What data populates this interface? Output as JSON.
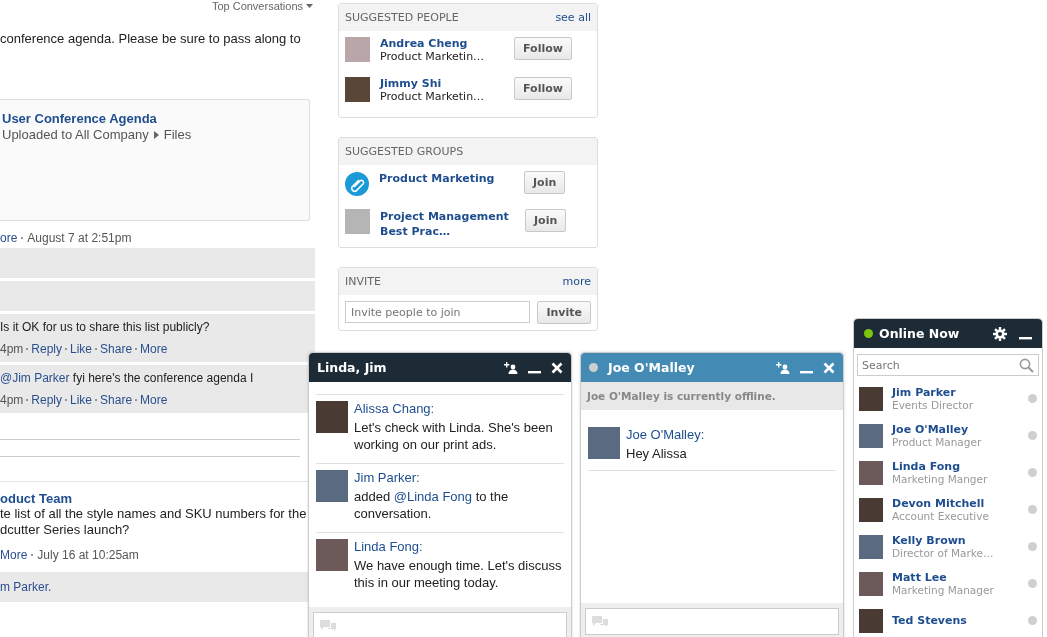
{
  "feed": {
    "sort_menu": "Top Conversations",
    "post_text": "conference agenda. Please be sure to pass along to",
    "attachment": {
      "title": "User Conference Agenda",
      "location": "Uploaded to All Company",
      "folder": "Files"
    },
    "post_meta": [
      {
        "text": "ore",
        "link": true
      },
      {
        "text": "August 7 at 2:51pm",
        "link": false
      }
    ],
    "comments": [
      {
        "text": "Is it OK for us to share this list publicly?",
        "actions": [
          {
            "text": "4pm",
            "link": false
          },
          {
            "text": "Reply",
            "link": true
          },
          {
            "text": "Like",
            "link": true
          },
          {
            "text": "Share",
            "link": true
          },
          {
            "text": "More",
            "link": true
          }
        ]
      },
      {
        "mention": "@Jim Parker",
        "text": "fyi here's the conference agenda I",
        "actions": [
          {
            "text": "4pm",
            "link": false
          },
          {
            "text": "Reply",
            "link": true
          },
          {
            "text": "Like",
            "link": true
          },
          {
            "text": "Share",
            "link": true
          },
          {
            "text": "More",
            "link": true
          }
        ]
      }
    ],
    "second_post": {
      "group": "oduct Team",
      "lines": [
        "te list of all the style names and SKU numbers for the",
        "dcutter Series launch?"
      ],
      "meta": [
        {
          "text": "More",
          "link": true
        },
        {
          "text": "July 16 at 10:25am",
          "link": false
        }
      ],
      "liked_by": "m Parker."
    }
  },
  "sidebar": {
    "people": {
      "title": "SUGGESTED PEOPLE",
      "link": "see all",
      "items": [
        {
          "name": "Andrea Cheng",
          "role": "Product Marketin…",
          "button": "Follow"
        },
        {
          "name": "Jimmy Shi",
          "role": "Product Marketin…",
          "button": "Follow"
        }
      ]
    },
    "groups": {
      "title": "SUGGESTED GROUPS",
      "items": [
        {
          "kind": "icon",
          "name": "Product Marketing",
          "button": "Join"
        },
        {
          "kind": "photo",
          "name": "Project Management Best Prac…",
          "button": "Join"
        }
      ]
    },
    "invite": {
      "title": "INVITE",
      "link": "more",
      "placeholder": "Invite people to join",
      "button": "Invite"
    }
  },
  "chats": [
    {
      "title": "Linda, Jim",
      "messages": [
        {
          "author": "Alissa Chang:",
          "parts": [
            {
              "text": "Let's check with Linda. She's been working on our print ads.",
              "mention": false
            }
          ]
        },
        {
          "author": "Jim Parker:",
          "parts": [
            {
              "text": "added ",
              "mention": false
            },
            {
              "text": "@Linda Fong",
              "mention": true
            },
            {
              "text": " to the conversation.",
              "mention": false
            }
          ]
        },
        {
          "author": "Linda Fong:",
          "parts": [
            {
              "text": "We have enough time. Let's discuss this in our meeting today.",
              "mention": false
            }
          ]
        }
      ]
    },
    {
      "title": "Joe O'Malley",
      "online": false,
      "notice": "Joe O'Malley is currently offline.",
      "messages": [
        {
          "author": "Joe O'Malley:",
          "parts": [
            {
              "text": "Hey Alissa",
              "mention": false
            }
          ]
        }
      ]
    }
  ],
  "online_panel": {
    "title": "Online Now",
    "online": true,
    "search_placeholder": "Search",
    "contacts": [
      {
        "name": "Jim Parker",
        "role": "Events Director",
        "online": false
      },
      {
        "name": "Joe O'Malley",
        "role": "Product Manager",
        "online": false
      },
      {
        "name": "Linda Fong",
        "role": "Marketing Manger",
        "online": false
      },
      {
        "name": "Devon Mitchell",
        "role": "Account Executive",
        "online": false
      },
      {
        "name": "Kelly Brown",
        "role": "Director of Marke…",
        "online": false
      },
      {
        "name": "Matt Lee",
        "role": "Marketing Manager",
        "online": false
      },
      {
        "name": "Ted Stevens",
        "online": false
      }
    ]
  }
}
